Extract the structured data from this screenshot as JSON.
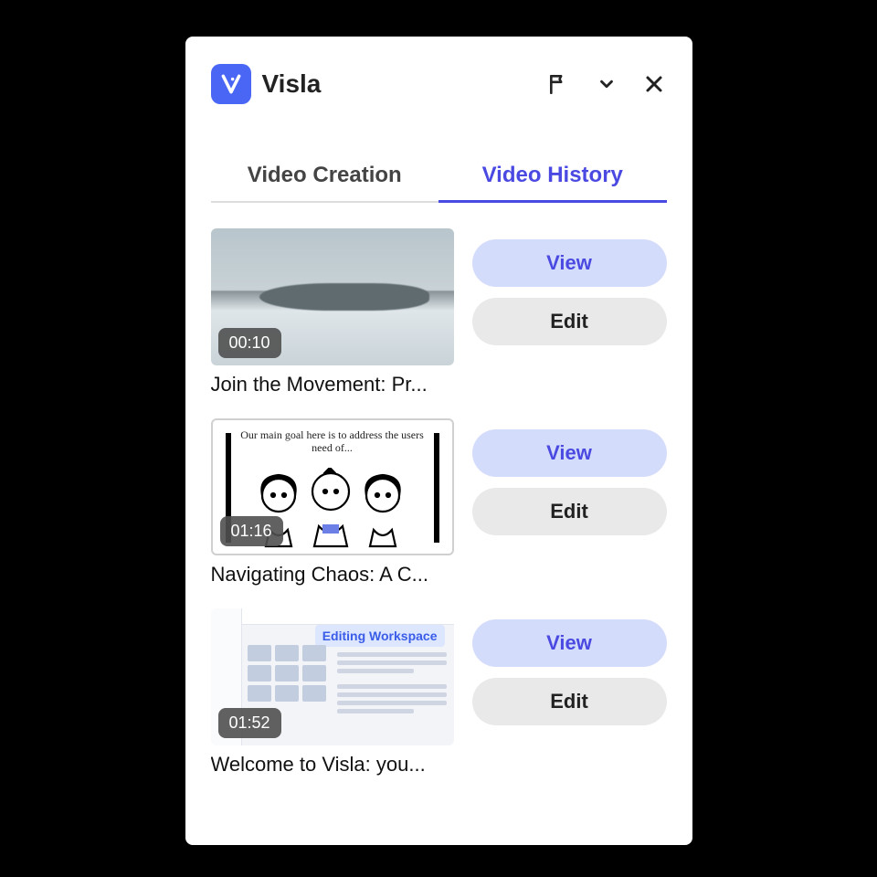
{
  "header": {
    "brand_name": "Visla"
  },
  "tabs": {
    "creation": "Video Creation",
    "history": "Video History",
    "active": "history"
  },
  "buttons": {
    "view": "View",
    "edit": "Edit"
  },
  "items": [
    {
      "duration": "00:10",
      "title": "Join the Movement: Pr...",
      "thumb_caption": ""
    },
    {
      "duration": "01:16",
      "title": "Navigating Chaos: A C...",
      "thumb_caption": "Our main goal here is to address the users need of..."
    },
    {
      "duration": "01:52",
      "title": "Welcome to Visla: you...",
      "thumb_badge": "Editing Workspace"
    }
  ]
}
